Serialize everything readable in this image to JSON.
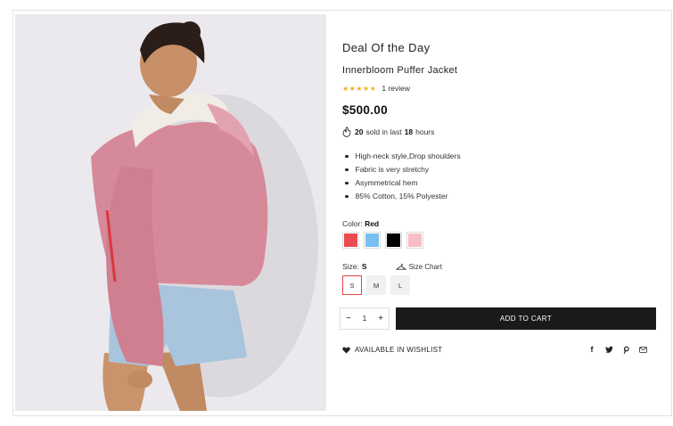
{
  "deal": {
    "title": "Deal Of the Day",
    "product_name": "Innerbloom Puffer Jacket",
    "rating": {
      "stars": "★★★★★",
      "value": 5,
      "max": 5,
      "review_text": "1 review",
      "star_color": "#f2b01e"
    },
    "price": "$500.00",
    "sold": {
      "count": "20",
      "text_mid": "sold in last",
      "hours": "18",
      "text_end": "hours",
      "icon": "fire-icon"
    },
    "features": [
      "High-neck style,Drop shoulders",
      "Fabric is very stretchy",
      "Asymmetrical hem",
      "85% Cotton, 15% Polyester"
    ],
    "color": {
      "label": "Color:",
      "selected": "Red",
      "swatches": [
        "#e94b4f",
        "#78bff0",
        "#000000",
        "#f8bdc6"
      ]
    },
    "size": {
      "label": "Size:",
      "selected": "S",
      "chart_label": "Size Chart",
      "options": [
        "S",
        "M",
        "L"
      ]
    },
    "quantity": {
      "minus": "−",
      "value": "1",
      "plus": "+"
    },
    "add_to_cart": "ADD TO CART",
    "wishlist": "AVAILABLE IN WISHLIST",
    "social": {
      "facebook": "f",
      "icons": [
        "facebook-icon",
        "twitter-icon",
        "pinterest-icon",
        "email-icon"
      ]
    }
  }
}
